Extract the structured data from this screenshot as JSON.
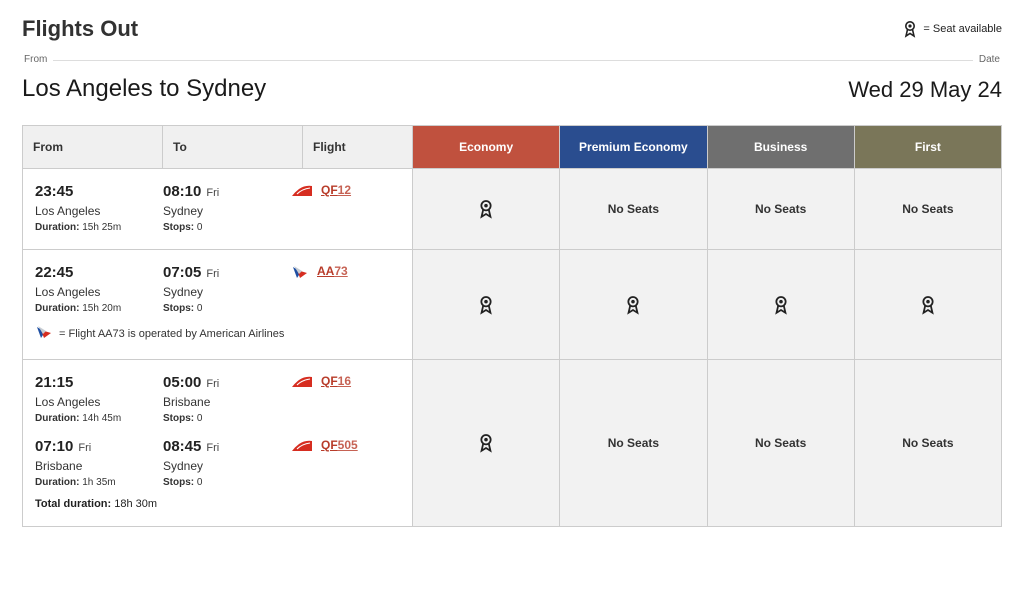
{
  "header": {
    "title": "Flights Out",
    "legend_text": "= Seat available"
  },
  "meta": {
    "from_label": "From",
    "date_label": "Date",
    "route": "Los Angeles to Sydney",
    "date": "Wed 29 May 24"
  },
  "columns": {
    "from": "From",
    "to": "To",
    "flight": "Flight",
    "economy": "Economy",
    "premium": "Premium Economy",
    "business": "Business",
    "first": "First"
  },
  "no_seats_text": "No Seats",
  "flights": [
    {
      "legs": [
        {
          "dep_time": "23:45",
          "dep_day": "",
          "dep_city": "Los Angeles",
          "duration": "15h 25m",
          "arr_time": "08:10",
          "arr_day": "Fri",
          "arr_city": "Sydney",
          "stops": "0",
          "carrier": "QF",
          "flight_code": "QF",
          "flight_num": "12"
        }
      ],
      "cabins": {
        "economy": "seat",
        "premium": "none",
        "business": "none",
        "first": "none"
      }
    },
    {
      "legs": [
        {
          "dep_time": "22:45",
          "dep_day": "",
          "dep_city": "Los Angeles",
          "duration": "15h 20m",
          "arr_time": "07:05",
          "arr_day": "Fri",
          "arr_city": "Sydney",
          "stops": "0",
          "carrier": "AA",
          "flight_code": "AA",
          "flight_num": "73"
        }
      ],
      "operated_note": "= Flight AA73 is operated by American Airlines",
      "cabins": {
        "economy": "seat",
        "premium": "seat",
        "business": "seat",
        "first": "seat"
      }
    },
    {
      "legs": [
        {
          "dep_time": "21:15",
          "dep_day": "",
          "dep_city": "Los Angeles",
          "duration": "14h 45m",
          "arr_time": "05:00",
          "arr_day": "Fri",
          "arr_city": "Brisbane",
          "stops": "0",
          "carrier": "QF",
          "flight_code": "QF",
          "flight_num": "16"
        },
        {
          "dep_time": "07:10",
          "dep_day": "Fri",
          "dep_city": "Brisbane",
          "duration": "1h 35m",
          "arr_time": "08:45",
          "arr_day": "Fri",
          "arr_city": "Sydney",
          "stops": "0",
          "carrier": "QF",
          "flight_code": "QF",
          "flight_num": "505"
        }
      ],
      "total_duration": "18h 30m",
      "cabins": {
        "economy": "seat",
        "premium": "none",
        "business": "none",
        "first": "none"
      }
    }
  ],
  "labels": {
    "duration": "Duration:",
    "stops": "Stops:",
    "total_duration": "Total duration:"
  }
}
